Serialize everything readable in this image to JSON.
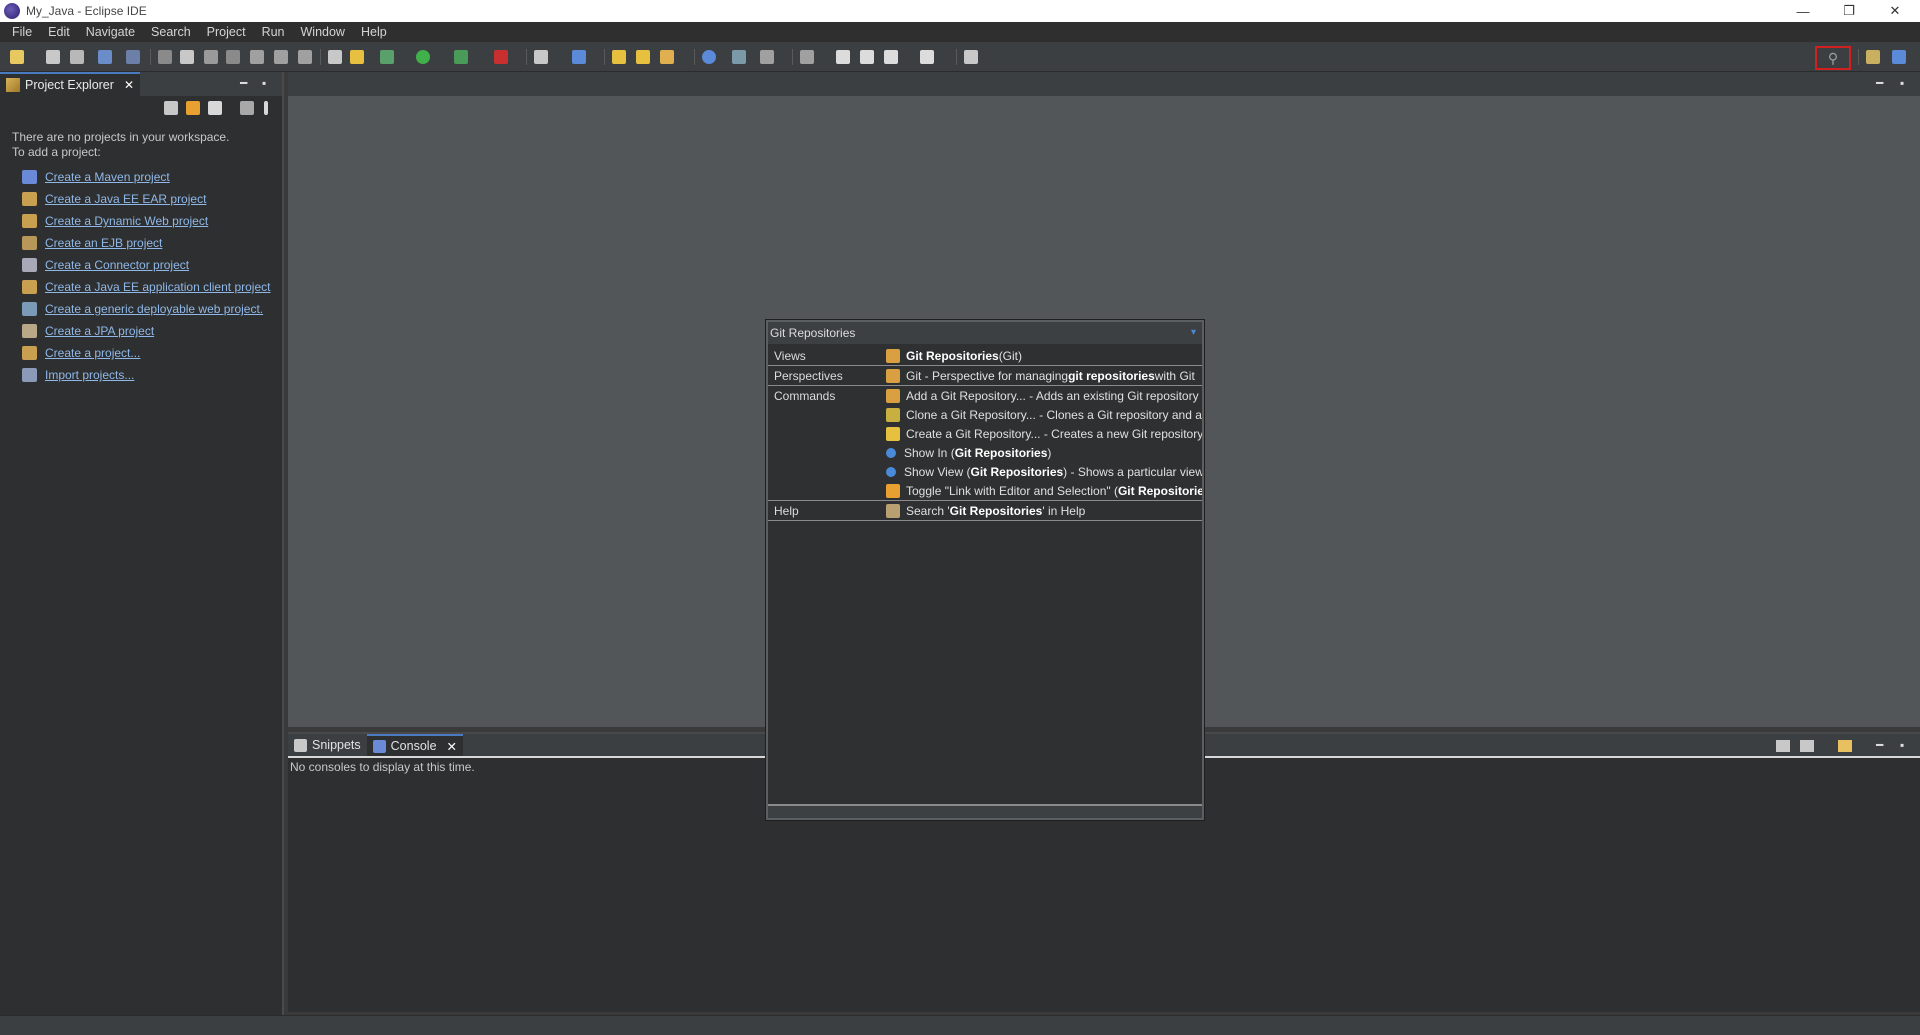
{
  "window": {
    "title": "My_Java - Eclipse IDE",
    "minimize": "—",
    "restore": "❐",
    "close": "✕"
  },
  "menu": [
    "File",
    "Edit",
    "Navigate",
    "Search",
    "Project",
    "Run",
    "Window",
    "Help"
  ],
  "project_explorer": {
    "tab_label": "Project Explorer",
    "close": "✕",
    "minimize": "━",
    "maximize": "▪",
    "message_line1": "There are no projects in your workspace.",
    "message_line2": "To add a project:",
    "links": [
      "Create a Maven project",
      "Create a Java EE EAR project",
      "Create a Dynamic Web project",
      "Create an EJB project",
      "Create a Connector project",
      "Create a Java EE application client project",
      "Create a generic deployable web project.",
      "Create a JPA project",
      "Create a project...",
      "Import projects..."
    ]
  },
  "editor": {
    "minimize": "━",
    "maximize": "▪"
  },
  "console": {
    "tabs": [
      "Snippets",
      "Console"
    ],
    "close": "✕",
    "message": "No consoles to display at this time.",
    "minimize": "━",
    "maximize": "▪"
  },
  "quick_access": {
    "title": "Git Repositories",
    "categories": {
      "views": "Views",
      "perspectives": "Perspectives",
      "commands": "Commands",
      "help": "Help"
    },
    "views_item": {
      "bold": "Git Repositories",
      "rest": " (Git)"
    },
    "perspectives_item": {
      "pre": "Git - Perspective for managing ",
      "bold": "git repositories",
      "rest": " with Git"
    },
    "commands": [
      {
        "pre": "Add a Git Repository... - Adds an existing Git repository to the Git Repositories view",
        "bold": "",
        "rest": ""
      },
      {
        "pre": "Clone a Git Repository... - Clones a Git repository and adds the clone to the Git Repositories view",
        "bold": "",
        "rest": ""
      },
      {
        "pre": "Create a Git Repository... - Creates a new Git repository and adds it to the Git Repositories view",
        "bold": "",
        "rest": ""
      },
      {
        "pre": "Show In (",
        "bold": "Git Repositories",
        "rest": ")"
      },
      {
        "pre": "Show View (",
        "bold": "Git Repositories",
        "rest": ") - Shows a particular view"
      },
      {
        "pre": "Toggle \"Link with Editor and Selection\" (",
        "bold": "Git Repositories",
        "rest": ")"
      }
    ],
    "help_item": {
      "pre": "Search '",
      "bold": "Git Repositories",
      "rest": "' in Help"
    }
  },
  "toolbar": {
    "search_icon": "⚲"
  },
  "colors": {
    "accent": "#4a7bc1",
    "highlight_border": "#d21f1f",
    "link": "#8fb8e8"
  }
}
